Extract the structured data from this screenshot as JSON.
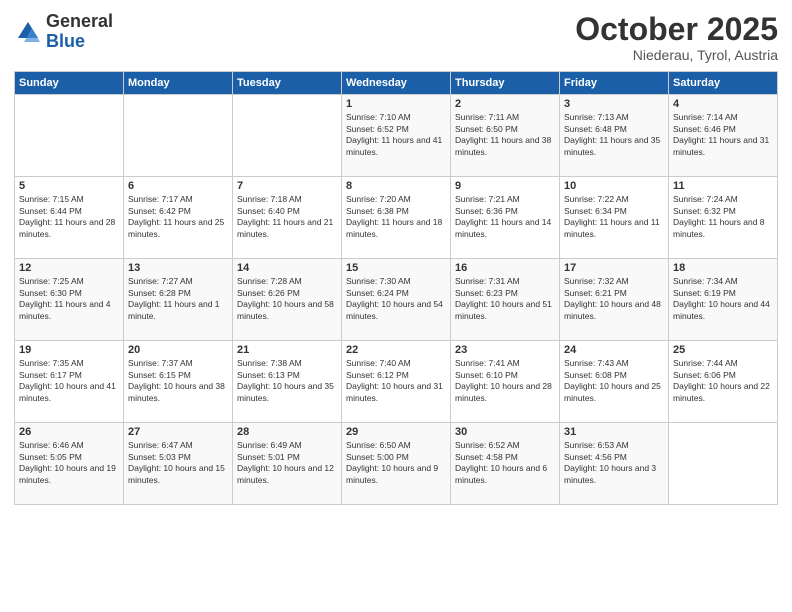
{
  "header": {
    "logo_general": "General",
    "logo_blue": "Blue",
    "month": "October 2025",
    "location": "Niederau, Tyrol, Austria"
  },
  "weekdays": [
    "Sunday",
    "Monday",
    "Tuesday",
    "Wednesday",
    "Thursday",
    "Friday",
    "Saturday"
  ],
  "weeks": [
    [
      {
        "day": "",
        "info": ""
      },
      {
        "day": "",
        "info": ""
      },
      {
        "day": "",
        "info": ""
      },
      {
        "day": "1",
        "info": "Sunrise: 7:10 AM\nSunset: 6:52 PM\nDaylight: 11 hours and 41 minutes."
      },
      {
        "day": "2",
        "info": "Sunrise: 7:11 AM\nSunset: 6:50 PM\nDaylight: 11 hours and 38 minutes."
      },
      {
        "day": "3",
        "info": "Sunrise: 7:13 AM\nSunset: 6:48 PM\nDaylight: 11 hours and 35 minutes."
      },
      {
        "day": "4",
        "info": "Sunrise: 7:14 AM\nSunset: 6:46 PM\nDaylight: 11 hours and 31 minutes."
      }
    ],
    [
      {
        "day": "5",
        "info": "Sunrise: 7:15 AM\nSunset: 6:44 PM\nDaylight: 11 hours and 28 minutes."
      },
      {
        "day": "6",
        "info": "Sunrise: 7:17 AM\nSunset: 6:42 PM\nDaylight: 11 hours and 25 minutes."
      },
      {
        "day": "7",
        "info": "Sunrise: 7:18 AM\nSunset: 6:40 PM\nDaylight: 11 hours and 21 minutes."
      },
      {
        "day": "8",
        "info": "Sunrise: 7:20 AM\nSunset: 6:38 PM\nDaylight: 11 hours and 18 minutes."
      },
      {
        "day": "9",
        "info": "Sunrise: 7:21 AM\nSunset: 6:36 PM\nDaylight: 11 hours and 14 minutes."
      },
      {
        "day": "10",
        "info": "Sunrise: 7:22 AM\nSunset: 6:34 PM\nDaylight: 11 hours and 11 minutes."
      },
      {
        "day": "11",
        "info": "Sunrise: 7:24 AM\nSunset: 6:32 PM\nDaylight: 11 hours and 8 minutes."
      }
    ],
    [
      {
        "day": "12",
        "info": "Sunrise: 7:25 AM\nSunset: 6:30 PM\nDaylight: 11 hours and 4 minutes."
      },
      {
        "day": "13",
        "info": "Sunrise: 7:27 AM\nSunset: 6:28 PM\nDaylight: 11 hours and 1 minute."
      },
      {
        "day": "14",
        "info": "Sunrise: 7:28 AM\nSunset: 6:26 PM\nDaylight: 10 hours and 58 minutes."
      },
      {
        "day": "15",
        "info": "Sunrise: 7:30 AM\nSunset: 6:24 PM\nDaylight: 10 hours and 54 minutes."
      },
      {
        "day": "16",
        "info": "Sunrise: 7:31 AM\nSunset: 6:23 PM\nDaylight: 10 hours and 51 minutes."
      },
      {
        "day": "17",
        "info": "Sunrise: 7:32 AM\nSunset: 6:21 PM\nDaylight: 10 hours and 48 minutes."
      },
      {
        "day": "18",
        "info": "Sunrise: 7:34 AM\nSunset: 6:19 PM\nDaylight: 10 hours and 44 minutes."
      }
    ],
    [
      {
        "day": "19",
        "info": "Sunrise: 7:35 AM\nSunset: 6:17 PM\nDaylight: 10 hours and 41 minutes."
      },
      {
        "day": "20",
        "info": "Sunrise: 7:37 AM\nSunset: 6:15 PM\nDaylight: 10 hours and 38 minutes."
      },
      {
        "day": "21",
        "info": "Sunrise: 7:38 AM\nSunset: 6:13 PM\nDaylight: 10 hours and 35 minutes."
      },
      {
        "day": "22",
        "info": "Sunrise: 7:40 AM\nSunset: 6:12 PM\nDaylight: 10 hours and 31 minutes."
      },
      {
        "day": "23",
        "info": "Sunrise: 7:41 AM\nSunset: 6:10 PM\nDaylight: 10 hours and 28 minutes."
      },
      {
        "day": "24",
        "info": "Sunrise: 7:43 AM\nSunset: 6:08 PM\nDaylight: 10 hours and 25 minutes."
      },
      {
        "day": "25",
        "info": "Sunrise: 7:44 AM\nSunset: 6:06 PM\nDaylight: 10 hours and 22 minutes."
      }
    ],
    [
      {
        "day": "26",
        "info": "Sunrise: 6:46 AM\nSunset: 5:05 PM\nDaylight: 10 hours and 19 minutes."
      },
      {
        "day": "27",
        "info": "Sunrise: 6:47 AM\nSunset: 5:03 PM\nDaylight: 10 hours and 15 minutes."
      },
      {
        "day": "28",
        "info": "Sunrise: 6:49 AM\nSunset: 5:01 PM\nDaylight: 10 hours and 12 minutes."
      },
      {
        "day": "29",
        "info": "Sunrise: 6:50 AM\nSunset: 5:00 PM\nDaylight: 10 hours and 9 minutes."
      },
      {
        "day": "30",
        "info": "Sunrise: 6:52 AM\nSunset: 4:58 PM\nDaylight: 10 hours and 6 minutes."
      },
      {
        "day": "31",
        "info": "Sunrise: 6:53 AM\nSunset: 4:56 PM\nDaylight: 10 hours and 3 minutes."
      },
      {
        "day": "",
        "info": ""
      }
    ]
  ]
}
